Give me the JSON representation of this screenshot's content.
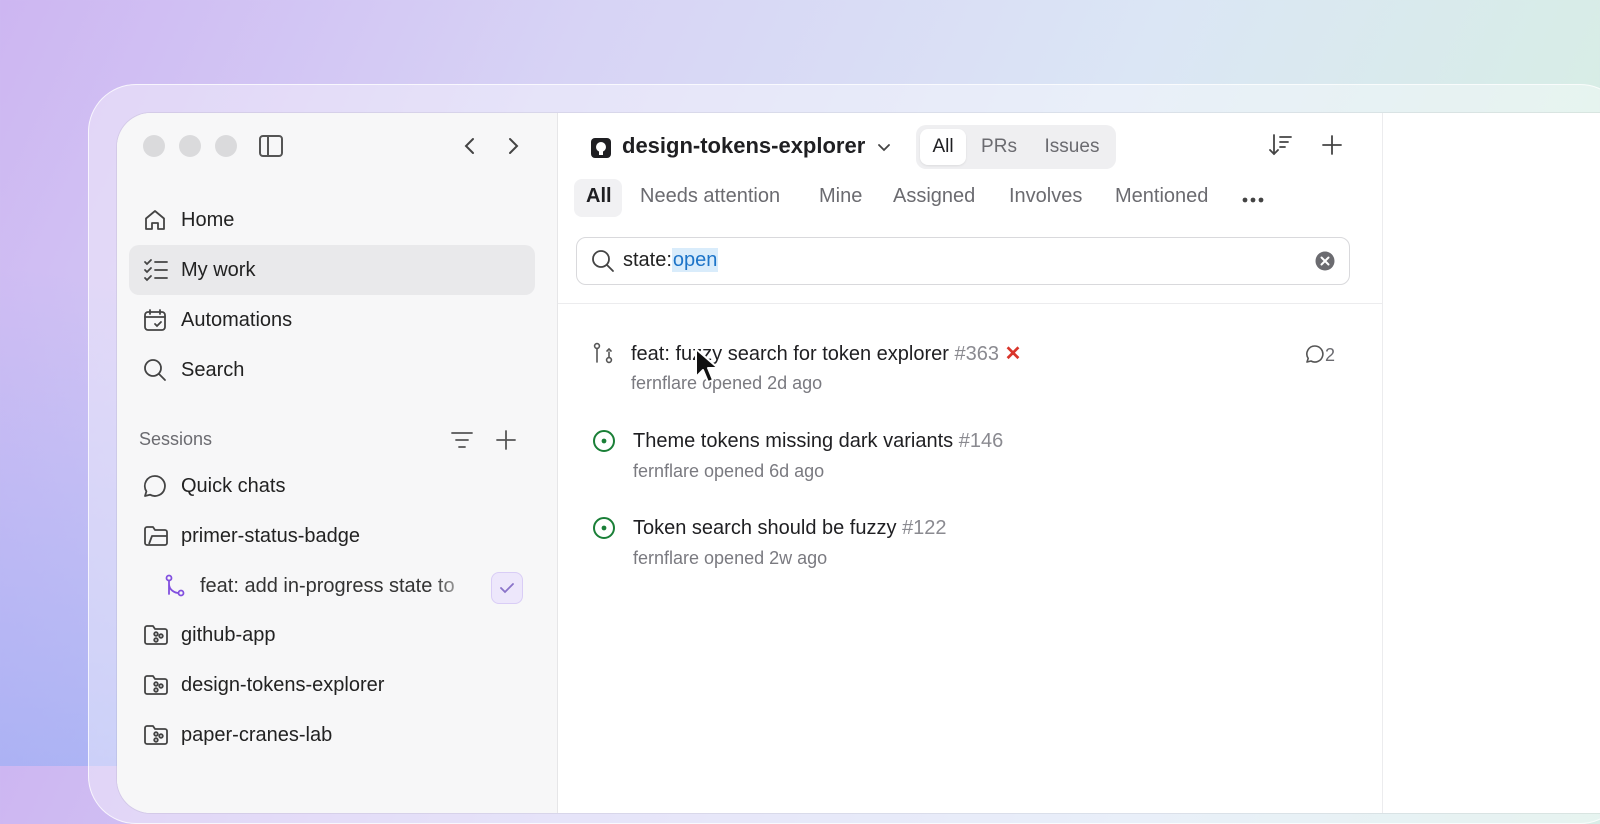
{
  "sidebar": {
    "nav": [
      {
        "label": "Home",
        "icon": "home-icon"
      },
      {
        "label": "My work",
        "icon": "checklist-icon"
      },
      {
        "label": "Automations",
        "icon": "calendar-icon"
      },
      {
        "label": "Search",
        "icon": "search-icon"
      }
    ],
    "sessions_label": "Sessions",
    "sessions": [
      {
        "label": "Quick chats",
        "icon": "chat-bubble-icon"
      },
      {
        "label": "primer-status-badge",
        "icon": "folder-icon"
      },
      {
        "label": "feat: add in-progress state to",
        "icon": "branch-icon"
      },
      {
        "label": "github-app",
        "icon": "repo-folder-icon"
      },
      {
        "label": "design-tokens-explorer",
        "icon": "repo-folder-icon"
      },
      {
        "label": "paper-cranes-lab",
        "icon": "repo-folder-icon"
      }
    ]
  },
  "header": {
    "repo_name": "design-tokens-explorer",
    "segments": [
      "All",
      "PRs",
      "Issues"
    ],
    "active_segment": "All"
  },
  "filters": [
    "All",
    "Needs attention",
    "Mine",
    "Assigned",
    "Involves",
    "Mentioned"
  ],
  "search": {
    "prefix": "state:",
    "value": "open"
  },
  "items": [
    {
      "title": "feat: fuzzy search for token explorer",
      "number": "#363",
      "meta": "fernflare opened 2d ago",
      "type": "pull-request",
      "status": "failing",
      "comments": "2"
    },
    {
      "title": "Theme tokens missing dark variants",
      "number": "#146",
      "meta": "fernflare opened 6d ago",
      "type": "issue"
    },
    {
      "title": "Token search should be fuzzy",
      "number": "#122",
      "meta": "fernflare opened 2w ago",
      "type": "issue"
    }
  ],
  "colors": {
    "issue_open": "#1a7f37",
    "fail": "#d9352b",
    "branch": "#8250df",
    "search_highlight": "#1d74c8"
  }
}
